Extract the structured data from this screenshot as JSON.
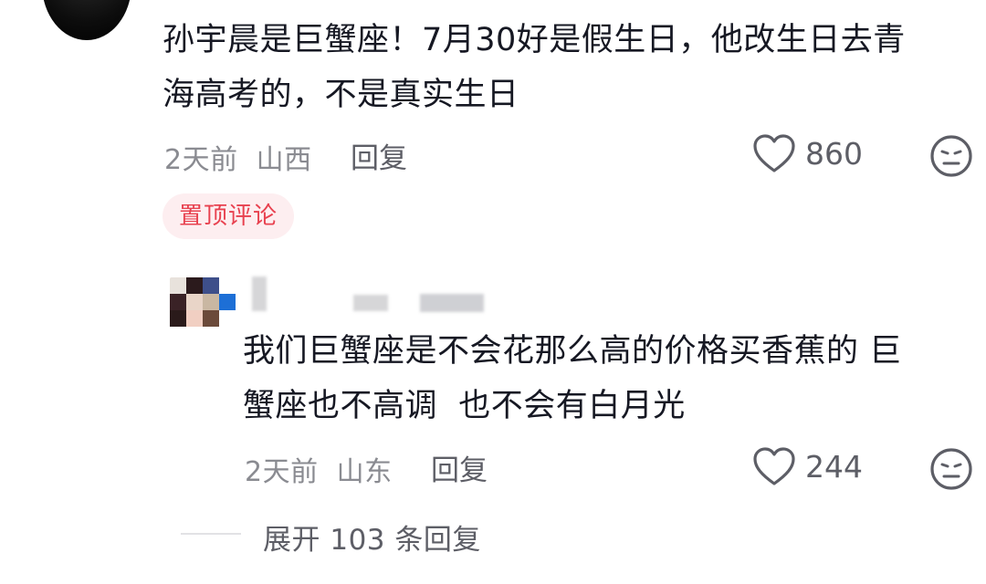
{
  "comment": {
    "text_line1": "孙宇晨是巨蟹座！7月30好是假生日，他改生日去青",
    "text_line2": "海高考的，不是真实生日",
    "time": "2天前",
    "location": "山西",
    "reply_label": "回复",
    "like_count": "860",
    "pinned_label": "置顶评论"
  },
  "reply": {
    "text_line1": "我们巨蟹座是不会花那么高的价格买香蕉的 巨",
    "text_line2": "蟹座也不高调  也不会有白月光",
    "time": "2天前",
    "location": "山东",
    "reply_label": "回复",
    "like_count": "244"
  },
  "expand": {
    "label": "展开 103 条回复"
  },
  "icons": {
    "like": "heart-outline-icon",
    "dislike": "neutral-face-icon"
  },
  "colors": {
    "text_primary": "#161823",
    "text_secondary": "#8a8b91",
    "icon": "#5d5e66",
    "pinned_bg": "#fdeef0",
    "pinned_text": "#e8414f"
  }
}
